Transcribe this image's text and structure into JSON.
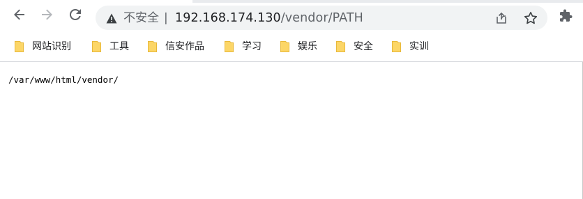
{
  "address_bar": {
    "security_label": "不安全",
    "separator": "|",
    "url_host": "192.168.174.130",
    "url_path": "/vendor/PATH"
  },
  "icons": {
    "back": "back-arrow-icon",
    "forward": "forward-arrow-icon",
    "reload": "reload-icon",
    "warning": "warning-triangle-icon",
    "share": "share-icon",
    "bookmark_star": "star-icon",
    "extensions": "puzzle-icon",
    "folder": "folder-icon"
  },
  "bookmarks": [
    {
      "label": "网站识别"
    },
    {
      "label": "工具"
    },
    {
      "label": "信安作品"
    },
    {
      "label": "学习"
    },
    {
      "label": "娱乐"
    },
    {
      "label": "安全"
    },
    {
      "label": "实训"
    }
  ],
  "page": {
    "body_text": "/var/www/html/vendor/"
  },
  "colors": {
    "omnibox_bg": "#f1f3f4",
    "folder_fill": "#fcd667",
    "icon_gray": "#5f6368",
    "text": "#202124"
  }
}
